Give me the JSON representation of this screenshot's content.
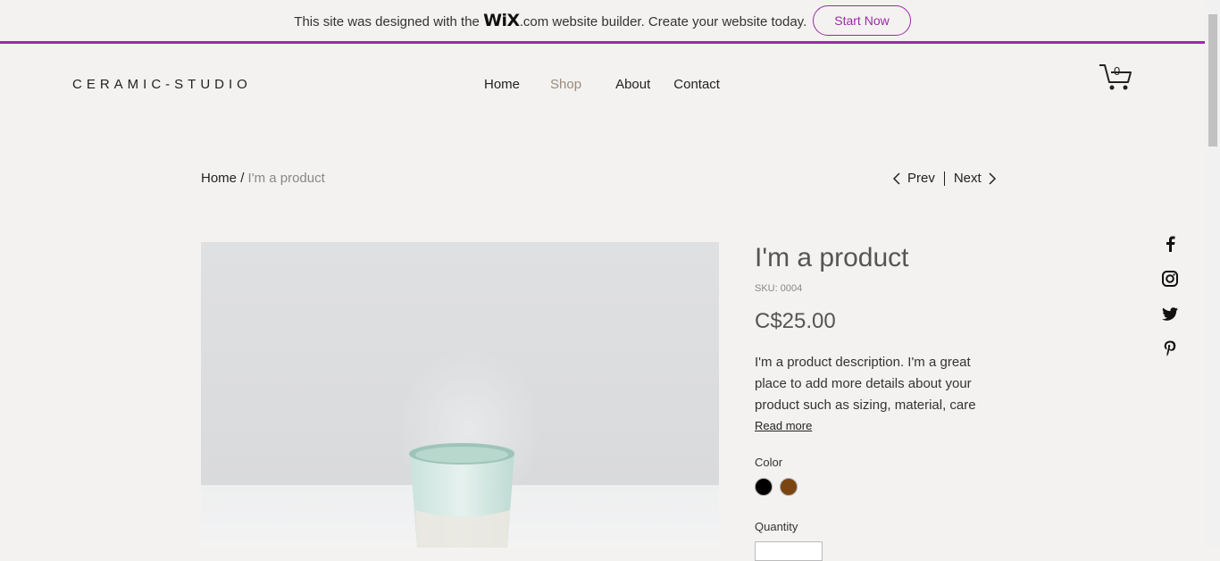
{
  "banner": {
    "text_before": "This site was designed with the",
    "brand": "WiX",
    "text_after": ".com website builder. Create your website today.",
    "cta": "Start Now",
    "accent": "#9b2aa6"
  },
  "header": {
    "logo": "CERAMIC-STUDIO",
    "nav": [
      {
        "label": "Home"
      },
      {
        "label": "Shop"
      },
      {
        "label": "About"
      },
      {
        "label": "Contact"
      }
    ],
    "cart_count": "0",
    "active_color": "#9a8c7e"
  },
  "breadcrumb": {
    "home": "Home",
    "separator": "/",
    "current": "I'm a product"
  },
  "pager": {
    "prev": "Prev",
    "next": "Next"
  },
  "product": {
    "title": "I'm a product",
    "sku": "SKU: 0004",
    "price": "C$25.00",
    "description": "I'm a product description. I'm a great place to add more details about your product such as sizing, material, care",
    "read_more": "Read more",
    "color_label": "Color",
    "colors": [
      "#000000",
      "#7a4510"
    ],
    "quantity_label": "Quantity"
  },
  "social": {
    "icons": [
      "facebook-icon",
      "instagram-icon",
      "twitter-icon",
      "pinterest-icon"
    ]
  }
}
